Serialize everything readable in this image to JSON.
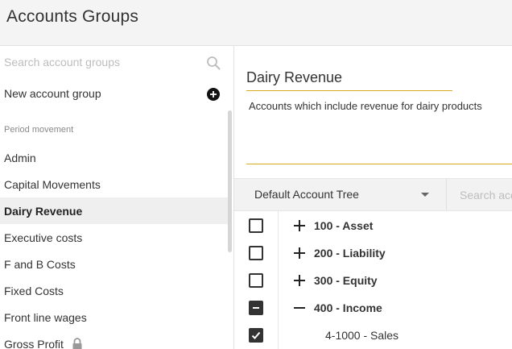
{
  "header": {
    "title": "Accounts Groups"
  },
  "sidebar": {
    "search_placeholder": "Search account groups",
    "new_group_label": "New account group",
    "section_label": "Period movement",
    "items": [
      {
        "label": "Admin",
        "selected": false,
        "locked": false
      },
      {
        "label": "Capital Movements",
        "selected": false,
        "locked": false
      },
      {
        "label": "Dairy Revenue",
        "selected": true,
        "locked": false
      },
      {
        "label": "Executive costs",
        "selected": false,
        "locked": false
      },
      {
        "label": "F and B Costs",
        "selected": false,
        "locked": false
      },
      {
        "label": "Fixed Costs",
        "selected": false,
        "locked": false
      },
      {
        "label": "Front line wages",
        "selected": false,
        "locked": false
      },
      {
        "label": "Gross Profit",
        "selected": false,
        "locked": true
      }
    ]
  },
  "main": {
    "name": "Dairy Revenue",
    "description": "Accounts which include revenue for dairy products",
    "tree_select": "Default Account Tree",
    "tree_search_placeholder": "Search accounts",
    "tree": [
      {
        "label": "100 - Asset",
        "state": "unchecked",
        "toggle": "expand"
      },
      {
        "label": "200 - Liability",
        "state": "unchecked",
        "toggle": "expand"
      },
      {
        "label": "300 - Equity",
        "state": "unchecked",
        "toggle": "expand"
      },
      {
        "label": "400 - Income",
        "state": "indeterminate",
        "toggle": "collapse"
      },
      {
        "label": "4-1000 - Sales",
        "state": "checked",
        "toggle": "none"
      }
    ]
  },
  "colors": {
    "accent": "#d9a91e",
    "selected_bg": "#efefef",
    "header_bg": "#f4f4f4"
  }
}
